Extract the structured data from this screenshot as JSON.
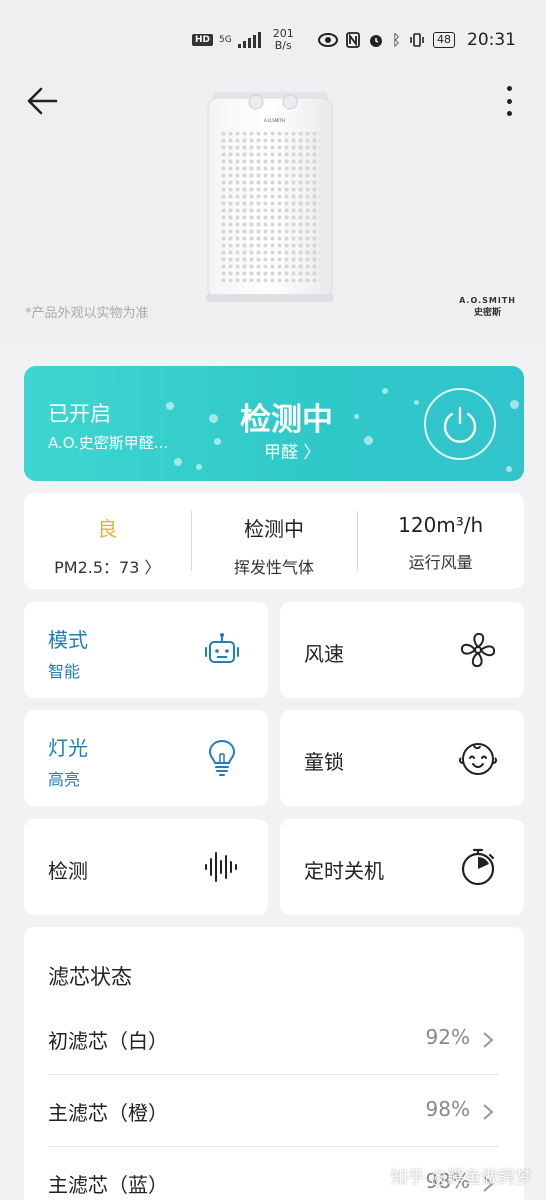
{
  "statusbar": {
    "hd": "HD",
    "network": "5G",
    "speed_value": "201",
    "speed_unit": "B/s",
    "battery": "48",
    "time": "20:31"
  },
  "hero": {
    "disclaimer": "*产品外观以实物为准",
    "brand_en": "A.O.SMITH",
    "brand_cn": "史密斯"
  },
  "status_card": {
    "power_state": "已开启",
    "device_name": "A.O.史密斯甲醛...",
    "detect_state": "检测中",
    "detect_target": "甲醛 〉"
  },
  "metrics": [
    {
      "value": "良",
      "label": "PM2.5：73 〉"
    },
    {
      "value": "检测中",
      "label": "挥发性气体"
    },
    {
      "value": "120m³/h",
      "label": "运行风量"
    }
  ],
  "tiles": {
    "mode": {
      "label": "模式",
      "value": "智能"
    },
    "fan_speed": {
      "label": "风速"
    },
    "light": {
      "label": "灯光",
      "value": "高亮"
    },
    "child_lock": {
      "label": "童锁"
    },
    "detection": {
      "label": "检测"
    },
    "timer_off": {
      "label": "定时关机"
    }
  },
  "filter": {
    "title": "滤芯状态",
    "items": [
      {
        "name": "初滤芯（白）",
        "percent": "92%"
      },
      {
        "name": "主滤芯（橙）",
        "percent": "98%"
      },
      {
        "name": "主滤芯（蓝）",
        "percent": "98%"
      }
    ]
  },
  "watermark": "知乎 @鳄鱼做鳄梦",
  "colors": {
    "accent_blue": "#1d7fc0",
    "status_teal": "#33cccb",
    "good_yellow": "#e0b536",
    "background": "#f2f2f4"
  },
  "icons": [
    "back-arrow-icon",
    "more-vert-icon",
    "power-icon",
    "robot-icon",
    "fan-icon",
    "bulb-icon",
    "baby-face-icon",
    "soundwave-icon",
    "timer-icon",
    "chevron-right-icon"
  ]
}
